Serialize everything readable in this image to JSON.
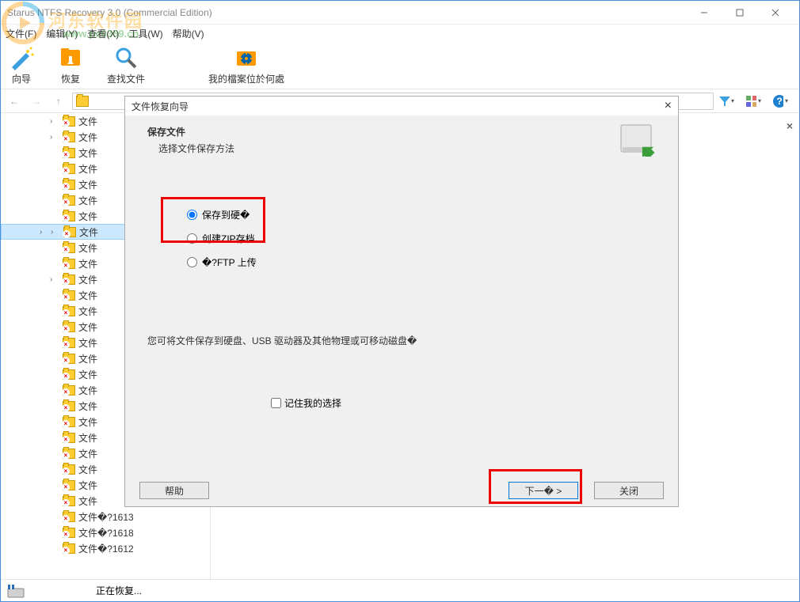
{
  "window": {
    "title": "Starus NTFS Recovery 3.0 (Commercial Edition)"
  },
  "watermark": {
    "text": "河东软件园",
    "url": "www.pc0359.cn"
  },
  "menu": {
    "file": "文件(F)",
    "edit": "编辑(Y)",
    "view": "查看(X)",
    "tools": "工具(W)",
    "help": "帮助(V)"
  },
  "toolbar": {
    "wizard": "向导",
    "recover": "恢复",
    "find_file": "查找文件",
    "where_files": "我的檔案位於何處"
  },
  "tree": {
    "label": "文件",
    "item_1613": "文件�?1613",
    "item_1618": "文件�?1618",
    "item_1612": "文件�?1612"
  },
  "status": {
    "text": "正在恢复..."
  },
  "dialog": {
    "title": "文件恢复向导",
    "heading": "保存文件",
    "subheading": "选择文件保存方法",
    "radio_hdd": "保存到硬�",
    "radio_zip": "创建ZIP存档",
    "radio_ftp": "�?FTP 上传",
    "description": "您可将文件保存到硬盘、USB 驱动器及其他物理或可移动磁盘�",
    "remember": "记住我的选择",
    "help_btn": "帮助",
    "next_btn": "下一� >",
    "close_btn": "关闭"
  }
}
